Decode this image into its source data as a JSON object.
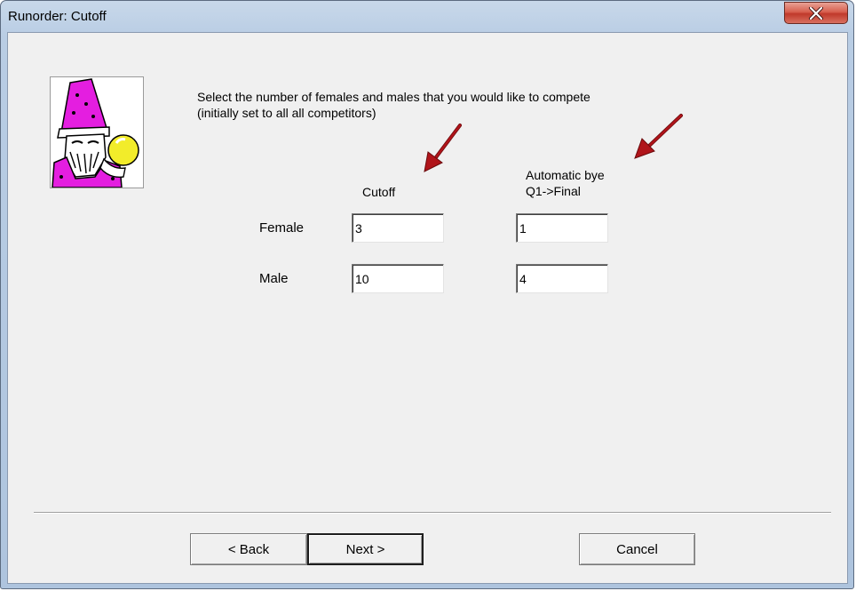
{
  "window": {
    "title": "Runorder: Cutoff"
  },
  "icons": {
    "close": "close-icon",
    "picture": "wizard-image",
    "arrows": "red-arrow-icon"
  },
  "instructions": {
    "line1": "Select the number of females and males that you would like to compete",
    "line2": "(initially set to all  all competitors)"
  },
  "columns": {
    "cutoff": "Cutoff",
    "bye_line1": "Automatic bye",
    "bye_line2": "Q1->Final"
  },
  "rows": {
    "female": {
      "label": "Female",
      "cutoff": "3",
      "bye": "1"
    },
    "male": {
      "label": "Male",
      "cutoff": "10",
      "bye": "4"
    }
  },
  "buttons": {
    "back": "< Back",
    "next": "Next >",
    "cancel": "Cancel"
  },
  "colors": {
    "arrow": "#b0141a",
    "close_button": "#c0392b",
    "dialog_face": "#f0f0f0"
  }
}
